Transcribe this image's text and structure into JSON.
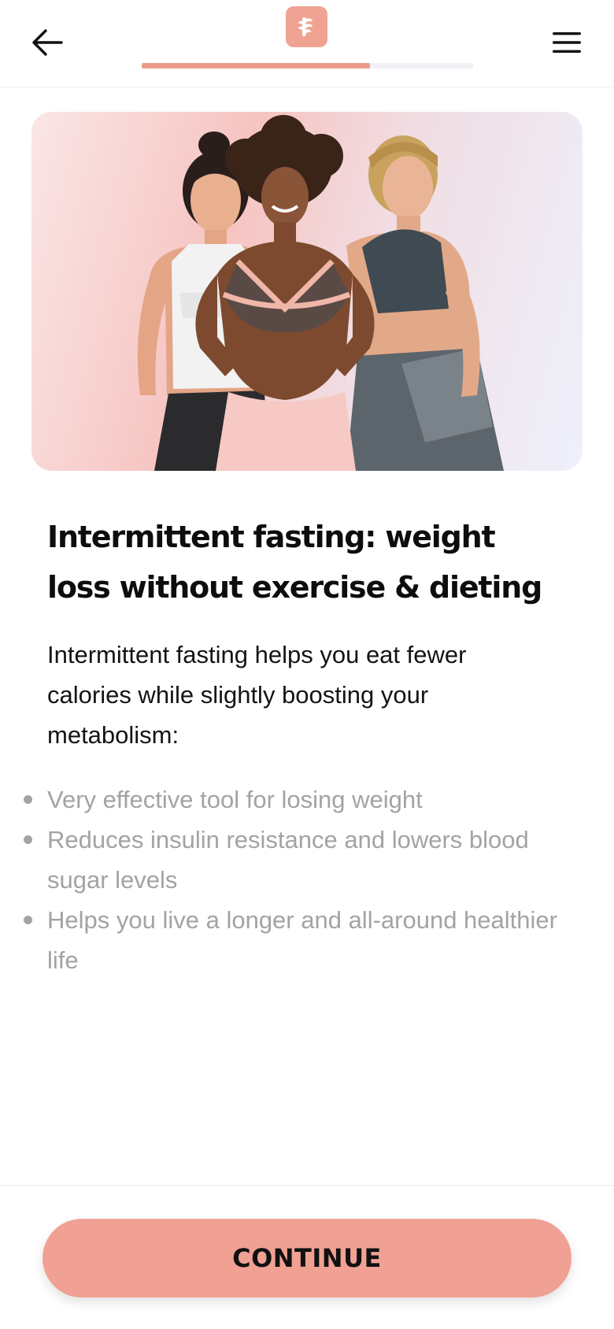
{
  "header": {
    "back_icon": "arrow-left-icon",
    "menu_icon": "hamburger-menu-icon",
    "logo_icon": "app-logo-icon",
    "progress_fraction": 0.69,
    "progress_color": "#ed9c8c"
  },
  "hero": {
    "image_subject": "three women in workout clothes"
  },
  "content": {
    "headline": "Intermittent fasting: weight loss without exercise & dieting",
    "intro": "Intermittent fasting helps you eat fewer calories while slightly boosting your metabolism:",
    "bullets": [
      "Very effective tool for losing weight",
      "Reduces insulin resistance and lowers blood sugar levels",
      "Helps you live a longer and all-around healthier life"
    ]
  },
  "footer": {
    "continue_label": "CONTINUE",
    "button_color": "#f0a193"
  }
}
